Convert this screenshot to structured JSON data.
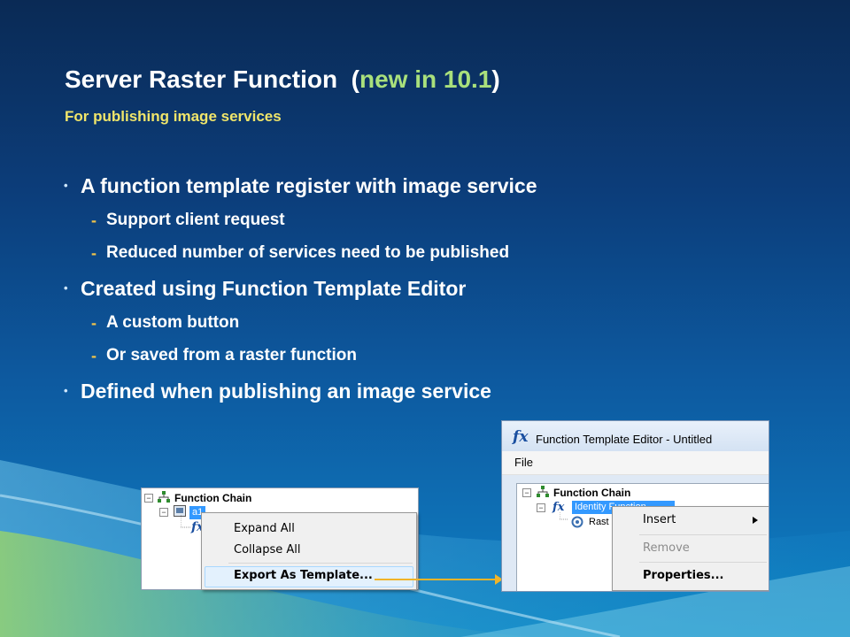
{
  "slide": {
    "title_main": "Server Raster Function",
    "title_open": "(",
    "title_highlight": "new in 10.1",
    "title_close": ")",
    "subtitle": "For publishing image services",
    "bullets": [
      {
        "text": "A function template register with image service",
        "subs": [
          "Support client request",
          "Reduced number of services need to be published"
        ]
      },
      {
        "text": "Created using Function Template Editor",
        "subs": [
          "A custom button",
          "Or saved from a raster function"
        ]
      },
      {
        "text": "Defined when publishing an image service",
        "subs": []
      }
    ]
  },
  "left_panel": {
    "root_label": "Function Chain",
    "selected_item": "a1",
    "context_menu": {
      "items": [
        "Expand All",
        "Collapse All",
        "Export As Template..."
      ],
      "highlighted_index": 2
    }
  },
  "editor_window": {
    "title": "Function Template Editor - Untitled",
    "menu_file": "File",
    "root_label": "Function Chain",
    "selected_item": "Identity Function",
    "child_item": "Rast",
    "context_menu": {
      "items": [
        "Insert",
        "Remove",
        "Properties..."
      ],
      "disabled_index": 1,
      "bold_index": 2
    }
  },
  "colors": {
    "title": "#ffffff",
    "title_highlight": "#a9e07c",
    "subtitle": "#f0e56a",
    "arrow": "#f0b428",
    "selection": "#3399ff"
  },
  "icons": [
    "function-chain-icon",
    "raster-icon",
    "fx-function-icon",
    "submenu-arrow-icon",
    "connector-arrow-icon"
  ]
}
